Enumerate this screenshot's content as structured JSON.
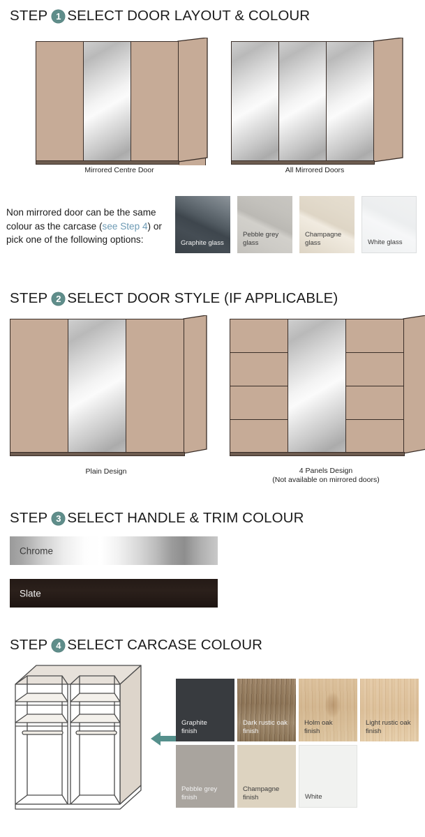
{
  "steps": [
    {
      "step_word": "STEP",
      "number": "1",
      "title": "SELECT DOOR LAYOUT & COLOUR"
    },
    {
      "step_word": "STEP",
      "number": "2",
      "title": "SELECT DOOR STYLE (IF APPLICABLE)"
    },
    {
      "step_word": "STEP",
      "number": "3",
      "title": "SELECT HANDLE & TRIM COLOUR"
    },
    {
      "step_word": "STEP",
      "number": "4",
      "title": "SELECT CARCASE COLOUR"
    }
  ],
  "step1": {
    "diagrams": [
      {
        "caption": "Mirrored Centre Door"
      },
      {
        "caption": "All Mirrored Doors"
      }
    ],
    "note": {
      "line1": "Non mirrored door can be the same",
      "line2_before": "colour as the carcase (",
      "line2_link": "see Step 4",
      "line2_after": ") or",
      "line3": "pick one of the following options:"
    },
    "glass_swatches": [
      {
        "label": "Graphite glass",
        "color": "#474f56",
        "text_tone": "light"
      },
      {
        "label": "Pebble grey\nglass",
        "color": "#c5c3be",
        "text_tone": "dark"
      },
      {
        "label": "Champagne\nglass",
        "color": "#e3dbcc",
        "text_tone": "dark"
      },
      {
        "label": "White glass",
        "color": "#f1f2f3",
        "text_tone": "dark"
      }
    ]
  },
  "step2": {
    "diagrams": [
      {
        "caption": "Plain Design",
        "caption2": ""
      },
      {
        "caption": "4 Panels Design",
        "caption2": "(Not available on mirrored doors)"
      }
    ]
  },
  "step3": {
    "bars": [
      {
        "label": "Chrome",
        "text_tone": "dark",
        "color": "#c9c9c9"
      },
      {
        "label": "Slate",
        "text_tone": "light",
        "color": "#241a16"
      }
    ]
  },
  "step4": {
    "finish_swatches": [
      {
        "label": "Graphite\nfinish",
        "color": "#383b3f",
        "text_tone": "light"
      },
      {
        "label": "Dark rustic oak\nfinish",
        "color": "#8d7456",
        "text_tone": "light"
      },
      {
        "label": "Holm oak\nfinish",
        "color": "#d3b68f",
        "text_tone": "dark"
      },
      {
        "label": "Light rustic oak\nfinish",
        "color": "#dcbf98",
        "text_tone": "dark"
      },
      {
        "label": "Pebble grey\nfinish",
        "color": "#a9a49e",
        "text_tone": "light"
      },
      {
        "label": "Champagne\nfinish",
        "color": "#ddd3c0",
        "text_tone": "dark"
      },
      {
        "label": "White",
        "color": "#f1f2f0",
        "text_tone": "dark"
      }
    ]
  },
  "colors": {
    "badge": "#5f8d8a",
    "arrow": "#55908c",
    "link": "#6d9bb5",
    "door_beige": "#c6ab97",
    "outline": "#3a2e28"
  }
}
